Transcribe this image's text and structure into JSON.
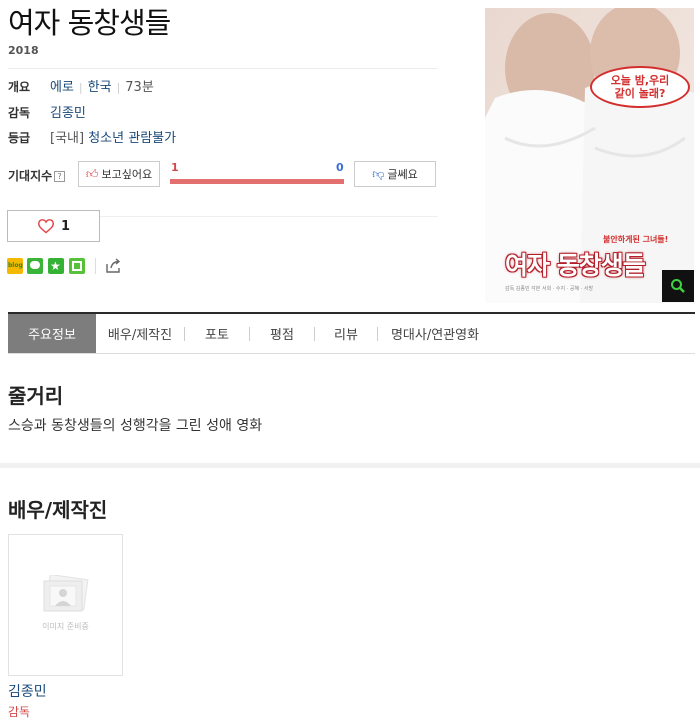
{
  "movie": {
    "title": "여자 동창생들",
    "year": "2018"
  },
  "info": {
    "overview_label": "개요",
    "genre": "에로",
    "country": "한국",
    "runtime": "73분",
    "director_label": "감독",
    "director": "김종민",
    "rating_label": "등급",
    "rating_prefix": "[국내]",
    "rating": "청소년 관람불가"
  },
  "expectation": {
    "label": "기대지수",
    "help": "?",
    "want_label": "보고싶어요",
    "dont_label": "글쎄요",
    "want_count": "1",
    "dont_count": "0",
    "want_fraction": 1.0
  },
  "like": {
    "count": "1"
  },
  "share_icons": [
    "naver-blog-icon",
    "line-icon",
    "star-bookmark-icon",
    "green-square-icon",
    "share-icon"
  ],
  "poster": {
    "speech": "오늘 밤,우리\n같이 놀래?",
    "tagline": "불안하게된 그녀들!",
    "big_title": "여자 동창생들",
    "credits": "감독 김종민   각본 서희 · 수지 · 공혜 · 서방"
  },
  "tabs": [
    {
      "label": "주요정보",
      "active": true
    },
    {
      "label": "배우/제작진",
      "active": false
    },
    {
      "label": "포토",
      "active": false
    },
    {
      "label": "평점",
      "active": false
    },
    {
      "label": "리뷰",
      "active": false
    },
    {
      "label": "명대사/연관영화",
      "active": false
    }
  ],
  "synopsis": {
    "heading": "줄거리",
    "text": "스승과 동창생들의 성행각을 그린 성애 영화"
  },
  "cast": {
    "heading": "배우/제작진",
    "placeholder": "이미지 준비중",
    "people": [
      {
        "name": "김종민",
        "role": "감독"
      }
    ]
  },
  "colors": {
    "accent_red": "#e46f6f",
    "link_blue": "#1a4a7a",
    "tab_active_bg": "#7d7d7d"
  }
}
